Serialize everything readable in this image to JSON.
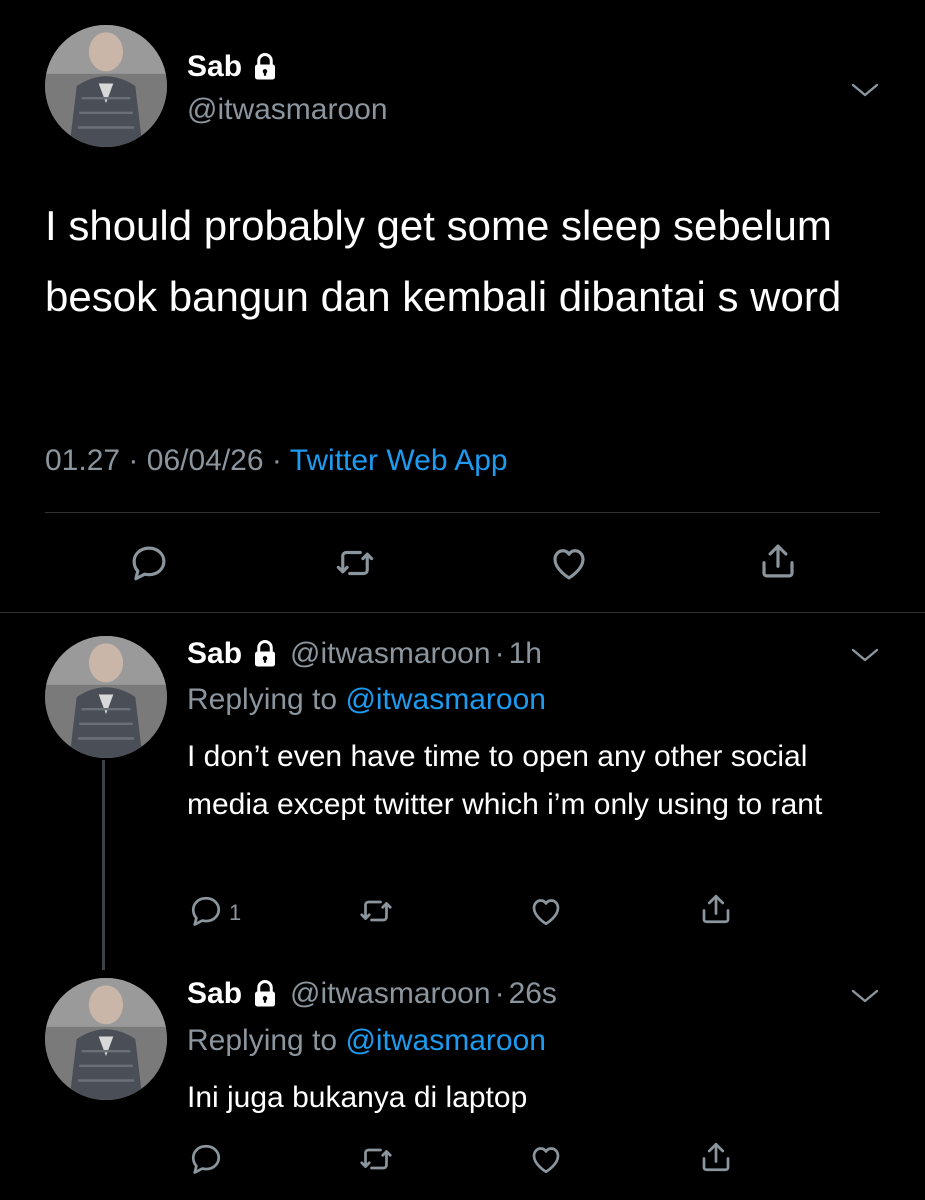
{
  "colors": {
    "background": "#000000",
    "text": "#ffffff",
    "muted": "#8b959e",
    "link": "#1d9bf0",
    "divider": "#2f3336"
  },
  "main_tweet": {
    "display_name": "Sab",
    "handle": "@itwasmaroon",
    "text": "I should probably get some sleep sebelum besok bangun dan kembali dibantai s word",
    "time": "01.27",
    "date": "06/04/26",
    "separator": "·",
    "source": "Twitter Web App",
    "icons": [
      "lock-icon",
      "chevron-down-icon",
      "reply-icon",
      "retweet-icon",
      "like-icon",
      "share-icon"
    ]
  },
  "replies": [
    {
      "display_name": "Sab",
      "handle": "@itwasmaroon",
      "separator": "·",
      "time": "1h",
      "replying_prefix": "Replying to",
      "replying_to": "@itwasmaroon",
      "text": "I don’t even have time to open any other social media except twitter which i’m only using to rant",
      "reply_count": "1"
    },
    {
      "display_name": "Sab",
      "handle": "@itwasmaroon",
      "separator": "·",
      "time": "26s",
      "replying_prefix": "Replying to",
      "replying_to": "@itwasmaroon",
      "text": "Ini juga bukanya di laptop",
      "reply_count": ""
    }
  ]
}
